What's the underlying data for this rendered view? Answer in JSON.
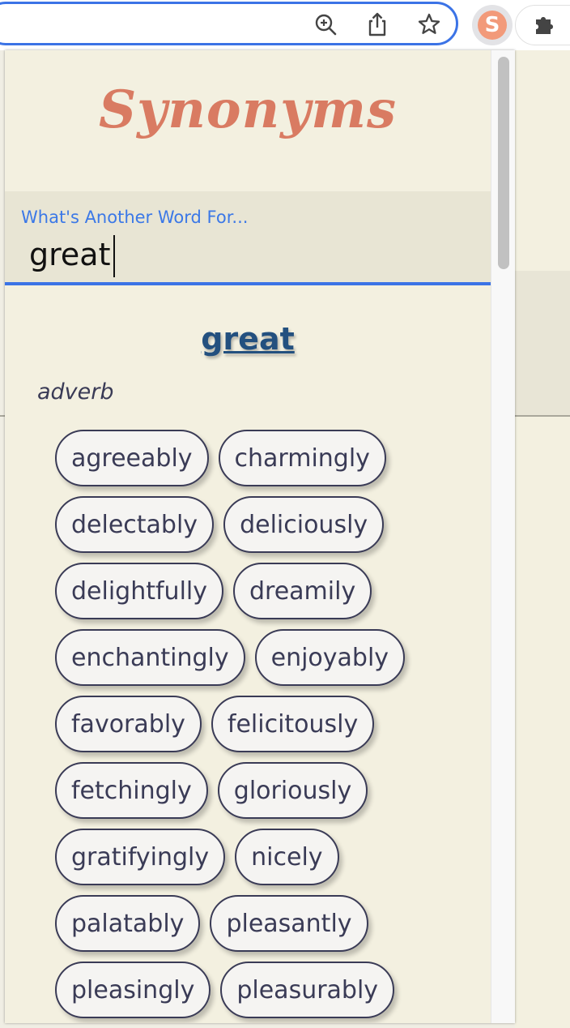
{
  "browser": {
    "icons": [
      "zoom-in-icon",
      "share-icon",
      "star-icon",
      "puzzle-icon"
    ],
    "extension_badge": "S",
    "accent": "#3b73e6"
  },
  "popup": {
    "logo": "Synonyms",
    "search": {
      "label": "What's Another Word For...",
      "value": "great"
    },
    "result": {
      "headword": "great",
      "part_of_speech": "adverb",
      "synonyms": [
        "agreeably",
        "charmingly",
        "delectably",
        "deliciously",
        "delightfully",
        "dreamily",
        "enchantingly",
        "enjoyably",
        "favorably",
        "felicitously",
        "fetchingly",
        "gloriously",
        "gratifyingly",
        "nicely",
        "palatably",
        "pleasantly",
        "pleasingly",
        "pleasurably"
      ]
    },
    "colors": {
      "logo": "#d97b62",
      "label": "#3b78e7",
      "headword": "#23507f",
      "chip_text": "#3a3b56",
      "background": "#f3f0e0"
    }
  }
}
